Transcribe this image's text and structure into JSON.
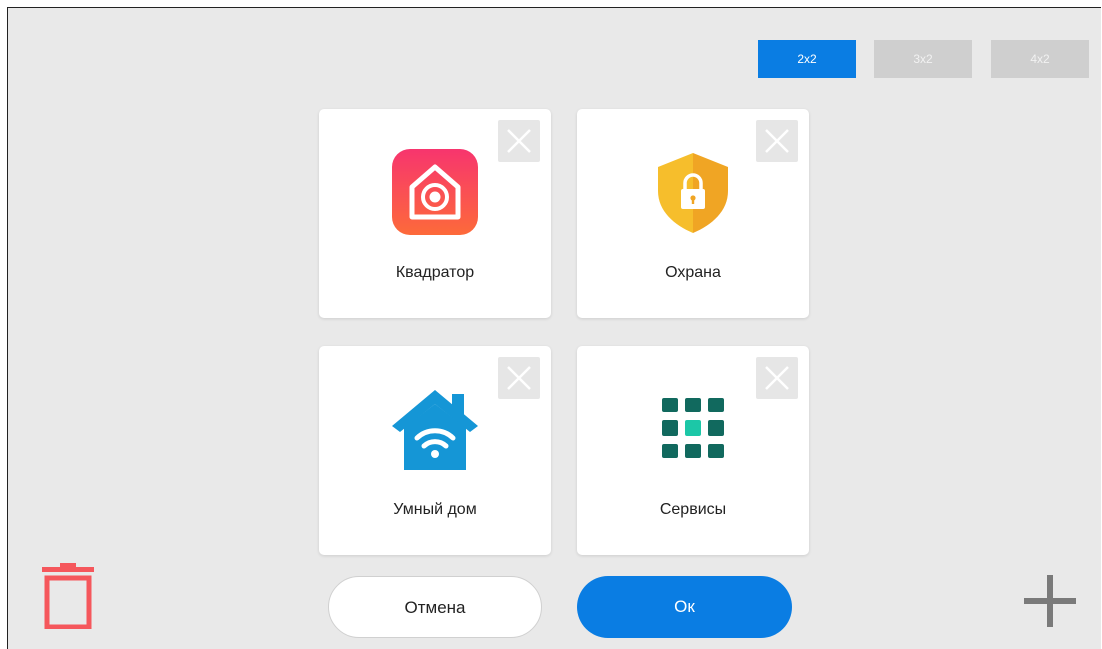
{
  "layout_options": {
    "selected": "2x2",
    "items": [
      {
        "label": "2x2",
        "active": true
      },
      {
        "label": "3x2",
        "active": false
      },
      {
        "label": "4x2",
        "active": false
      }
    ]
  },
  "tiles": [
    {
      "label": "Квадратор",
      "icon": "camera-home-icon"
    },
    {
      "label": "Охрана",
      "icon": "security-shield-lock-icon"
    },
    {
      "label": "Умный дом",
      "icon": "smart-home-wifi-icon"
    },
    {
      "label": "Сервисы",
      "icon": "services-grid-icon"
    }
  ],
  "actions": {
    "cancel_label": "Отмена",
    "ok_label": "Ок"
  },
  "icons": {
    "delete": "trash-icon",
    "add": "plus-icon"
  },
  "colors": {
    "accent": "#0a7de3",
    "delete": "#f5575c",
    "background": "#e9e9e9"
  }
}
